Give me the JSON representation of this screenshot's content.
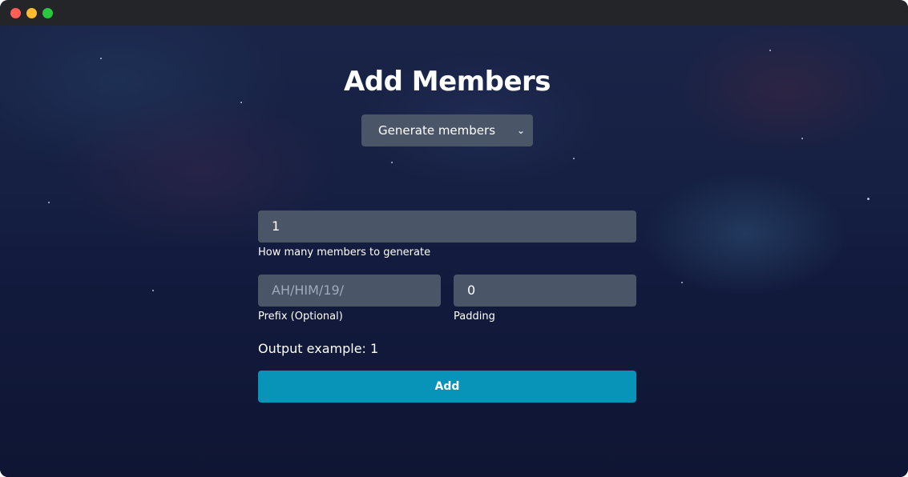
{
  "page": {
    "title": "Add Members"
  },
  "mode_select": {
    "selected": "Generate members",
    "chevron": "⌄"
  },
  "count_field": {
    "value": "1",
    "label": "How many members to generate"
  },
  "prefix_field": {
    "placeholder": "AH/HIM/19/",
    "label": "Prefix (Optional)"
  },
  "padding_field": {
    "value": "0",
    "label": "Padding"
  },
  "output": {
    "text": "Output example: 1"
  },
  "add_button": {
    "label": "Add"
  },
  "colors": {
    "accent": "#0894b8",
    "field_bg": "#4a5568",
    "titlebar": "#232528"
  }
}
